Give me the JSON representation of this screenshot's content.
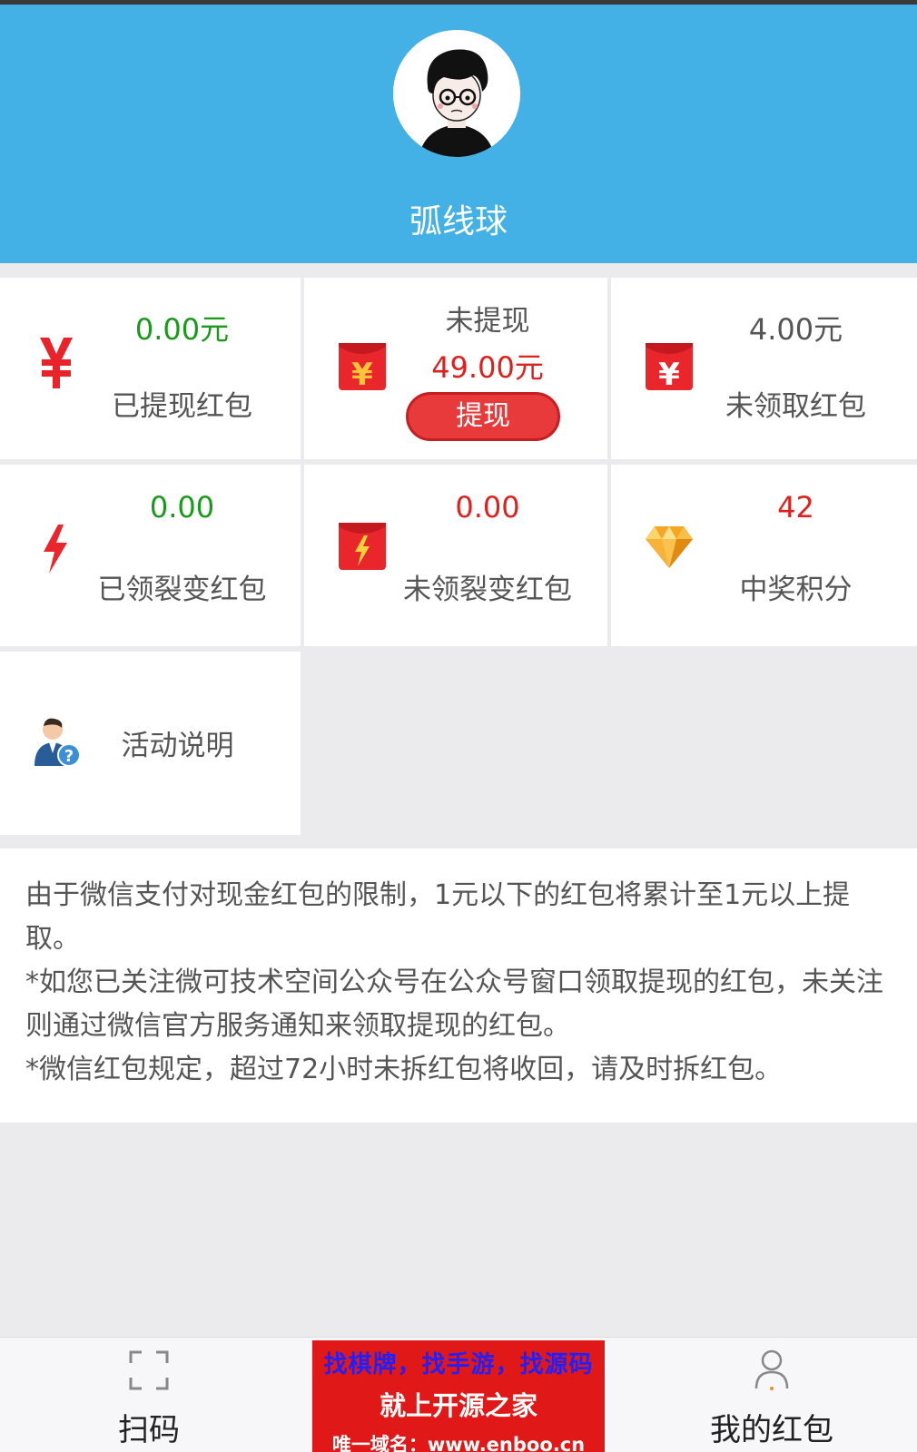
{
  "profile": {
    "username": "弧线球"
  },
  "grid": {
    "withdrawn": {
      "value": "0.00元",
      "label": "已提现红包"
    },
    "pending": {
      "title": "未提现",
      "value": "49.00元",
      "button": "提现"
    },
    "unclaimed": {
      "value": "4.00元",
      "label": "未领取红包"
    },
    "fission_claimed": {
      "value": "0.00",
      "label": "已领裂变红包"
    },
    "fission_unclaimed": {
      "value": "0.00",
      "label": "未领裂变红包"
    },
    "points": {
      "value": "42",
      "label": "中奖积分"
    },
    "rules": {
      "label": "活动说明"
    }
  },
  "notice": {
    "line1": "由于微信支付对现金红包的限制，1元以下的红包将累计至1元以上提取。",
    "line2": "*如您已关注微可技术空间公众号在公众号窗口领取提现的红包，未关注则通过微信官方服务通知来领取提现的红包。",
    "line3": "*微信红包规定，超过72小时未拆红包将收回，请及时拆红包。"
  },
  "tabbar": {
    "scan": "扫码",
    "my": "我的红包"
  },
  "ad": {
    "line1": "找棋牌，找手游，找源码",
    "line2": "就上开源之家",
    "line3": "唯一域名：www.enboo.cn"
  },
  "colors": {
    "header": "#43b1e6",
    "green": "#1a9a1a",
    "red": "#e0201c",
    "button": "#e8393b"
  }
}
